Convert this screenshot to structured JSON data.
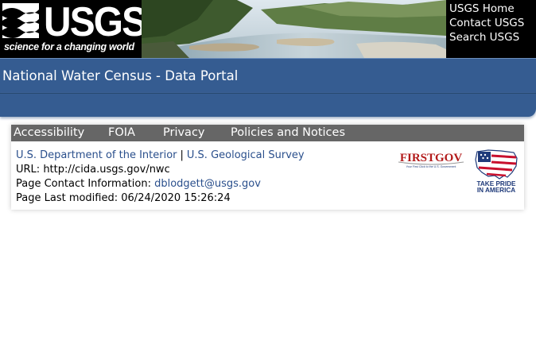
{
  "header": {
    "logo_wordmark": "USGS",
    "logo_tagline": "science for a changing world",
    "links": [
      "USGS Home",
      "Contact USGS",
      "Search USGS"
    ]
  },
  "title_bar": {
    "title": "National Water Census - Data Portal"
  },
  "footer": {
    "nav": [
      "Accessibility",
      "FOIA",
      "Privacy",
      "Policies and Notices"
    ],
    "doi_link": "U.S. Department of the Interior",
    "separator": "|",
    "usgs_link": "U.S. Geological Survey",
    "url_label": "URL:",
    "url_value": "http://cida.usgs.gov/nwc",
    "contact_label": "Page Contact Information:",
    "contact_email": "dblodgett@usgs.gov",
    "modified_label": "Page Last modified:",
    "modified_value": "06/24/2020 15:26:24",
    "firstgov_logo": "FIRSTGOV",
    "firstgov_tagline": "Your First Click to the U.S. Government",
    "pride_logo_line1": "TAKE PRIDE",
    "pride_logo_line2": "IN AMERICA"
  },
  "colors": {
    "title_bar": "#355c91",
    "footer_nav": "#666666",
    "link": "#2a4f8c"
  }
}
